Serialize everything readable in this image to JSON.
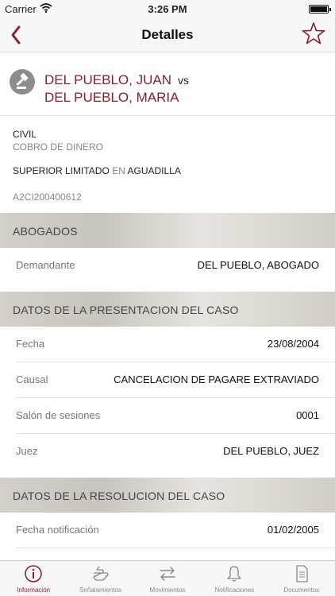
{
  "status_bar": {
    "carrier": "Carrier",
    "time": "3:26 PM"
  },
  "nav": {
    "title": "Detalles"
  },
  "case": {
    "party_1": "DEL PUEBLO, JUAN",
    "vs": "vs",
    "party_2": "DEL PUEBLO, MARIA",
    "type": "CIVIL",
    "subtype": "COBRO DE DINERO",
    "court": "SUPERIOR LIMITADO",
    "en": "EN",
    "location": "AGUADILLA",
    "number": "A2CI200400612"
  },
  "sections": {
    "abogados": "ABOGADOS",
    "presentacion": "DATOS DE LA PRESENTACION DEL CASO",
    "resolucion": "DATOS DE LA RESOLUCION DEL CASO"
  },
  "rows": {
    "demandante": {
      "label": "Demandante",
      "value": "DEL PUEBLO, ABOGADO"
    },
    "fecha": {
      "label": "Fecha",
      "value": "23/08/2004"
    },
    "causal": {
      "label": "Causal",
      "value": "CANCELACION DE PAGARE EXTRAVIADO"
    },
    "salon": {
      "label": "Salón de sesiones",
      "value": "0001"
    },
    "juez": {
      "label": "Juez",
      "value": "DEL PUEBLO, JUEZ"
    },
    "fecha_notificacion": {
      "label": "Fecha notificación",
      "value": "01/02/2005"
    }
  },
  "tabs": [
    {
      "label": "Información",
      "icon": "info-icon"
    },
    {
      "label": "Señalamientos",
      "icon": "pointing-hand-icon"
    },
    {
      "label": "Movimientos",
      "icon": "arrows-icon"
    },
    {
      "label": "Notificaciones",
      "icon": "bell-icon"
    },
    {
      "label": "Documentos",
      "icon": "document-icon"
    }
  ],
  "colors": {
    "accent": "#8a1e2c",
    "section_bg": "#d4d0c9"
  }
}
